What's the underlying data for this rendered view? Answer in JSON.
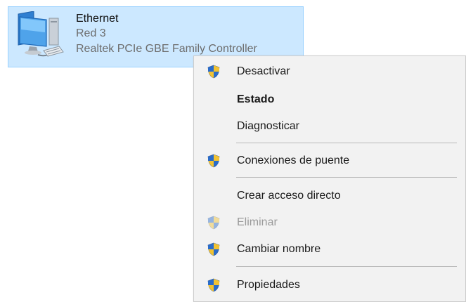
{
  "adapter": {
    "name": "Ethernet",
    "network": "Red  3",
    "device": "Realtek PCIe GBE Family Controller",
    "icon": "network-adapter-icon",
    "selection_color": "#cce8ff"
  },
  "context_menu": {
    "items": [
      {
        "label": "Desactivar",
        "icon": "uac-shield-icon",
        "bold": false,
        "disabled": false
      },
      {
        "label": "Estado",
        "icon": null,
        "bold": true,
        "disabled": false
      },
      {
        "label": "Diagnosticar",
        "icon": null,
        "bold": false,
        "disabled": false
      },
      {
        "label": "Conexiones de puente",
        "icon": "uac-shield-icon",
        "bold": false,
        "disabled": false
      },
      {
        "label": "Crear acceso directo",
        "icon": null,
        "bold": false,
        "disabled": false
      },
      {
        "label": "Eliminar",
        "icon": "uac-shield-icon",
        "bold": false,
        "disabled": true
      },
      {
        "label": "Cambiar nombre",
        "icon": "uac-shield-icon",
        "bold": false,
        "disabled": false
      },
      {
        "label": "Propiedades",
        "icon": "uac-shield-icon",
        "bold": false,
        "disabled": false
      }
    ]
  }
}
